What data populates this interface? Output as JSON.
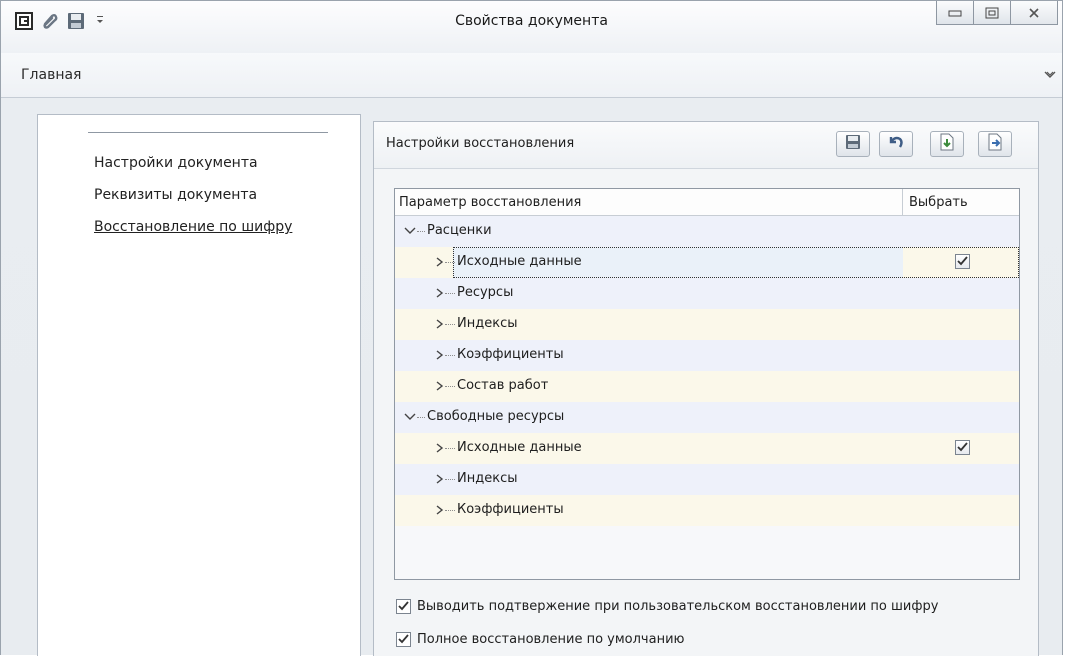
{
  "window": {
    "title": "Свойства документа"
  },
  "ribbon": {
    "tab_main": "Главная"
  },
  "nav": {
    "items": [
      {
        "label": "Настройки документа",
        "active": false
      },
      {
        "label": "Реквизиты документа",
        "active": false
      },
      {
        "label": "Восстановление по шифру",
        "active": true
      }
    ]
  },
  "panel": {
    "title": "Настройки восстановления"
  },
  "grid": {
    "columns": [
      "Параметр восстановления",
      "Выбрать"
    ],
    "rows": [
      {
        "label": "Расценки",
        "level": 0,
        "expanded": true,
        "checked": false
      },
      {
        "label": "Исходные данные",
        "level": 1,
        "checked": true,
        "selected": true
      },
      {
        "label": "Ресурсы",
        "level": 1,
        "checked": false
      },
      {
        "label": "Индексы",
        "level": 1,
        "checked": false
      },
      {
        "label": "Коэффициенты",
        "level": 1,
        "checked": false
      },
      {
        "label": "Состав работ",
        "level": 1,
        "checked": false
      },
      {
        "label": "Свободные ресурсы",
        "level": 0,
        "expanded": true,
        "checked": false
      },
      {
        "label": "Исходные данные",
        "level": 1,
        "checked": true
      },
      {
        "label": "Индексы",
        "level": 1,
        "checked": false
      },
      {
        "label": "Коэффициенты",
        "level": 1,
        "checked": false
      }
    ]
  },
  "options": {
    "confirm_label": "Выводить подтвержение при пользовательском восстановлении по шифру",
    "confirm_checked": true,
    "full_restore_label": "Полное восстановление по умолчанию",
    "full_restore_checked": true
  }
}
